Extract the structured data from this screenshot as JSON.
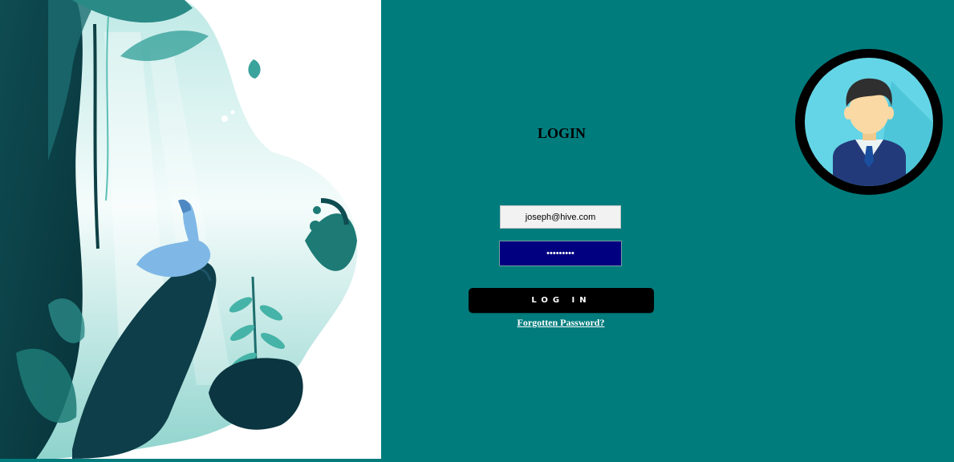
{
  "login": {
    "title": "LOGIN",
    "email_value": "joseph@hive.com",
    "password_value": "•••••••••",
    "submit_label": "LOG IN",
    "forgot_link": "Forgotten Password?"
  },
  "theme": {
    "background": "#017c7d",
    "password_field_bg": "#000080",
    "button_bg": "#000000"
  },
  "icons": {
    "hero": "jungle-illustration",
    "avatar": "user-avatar-icon"
  }
}
